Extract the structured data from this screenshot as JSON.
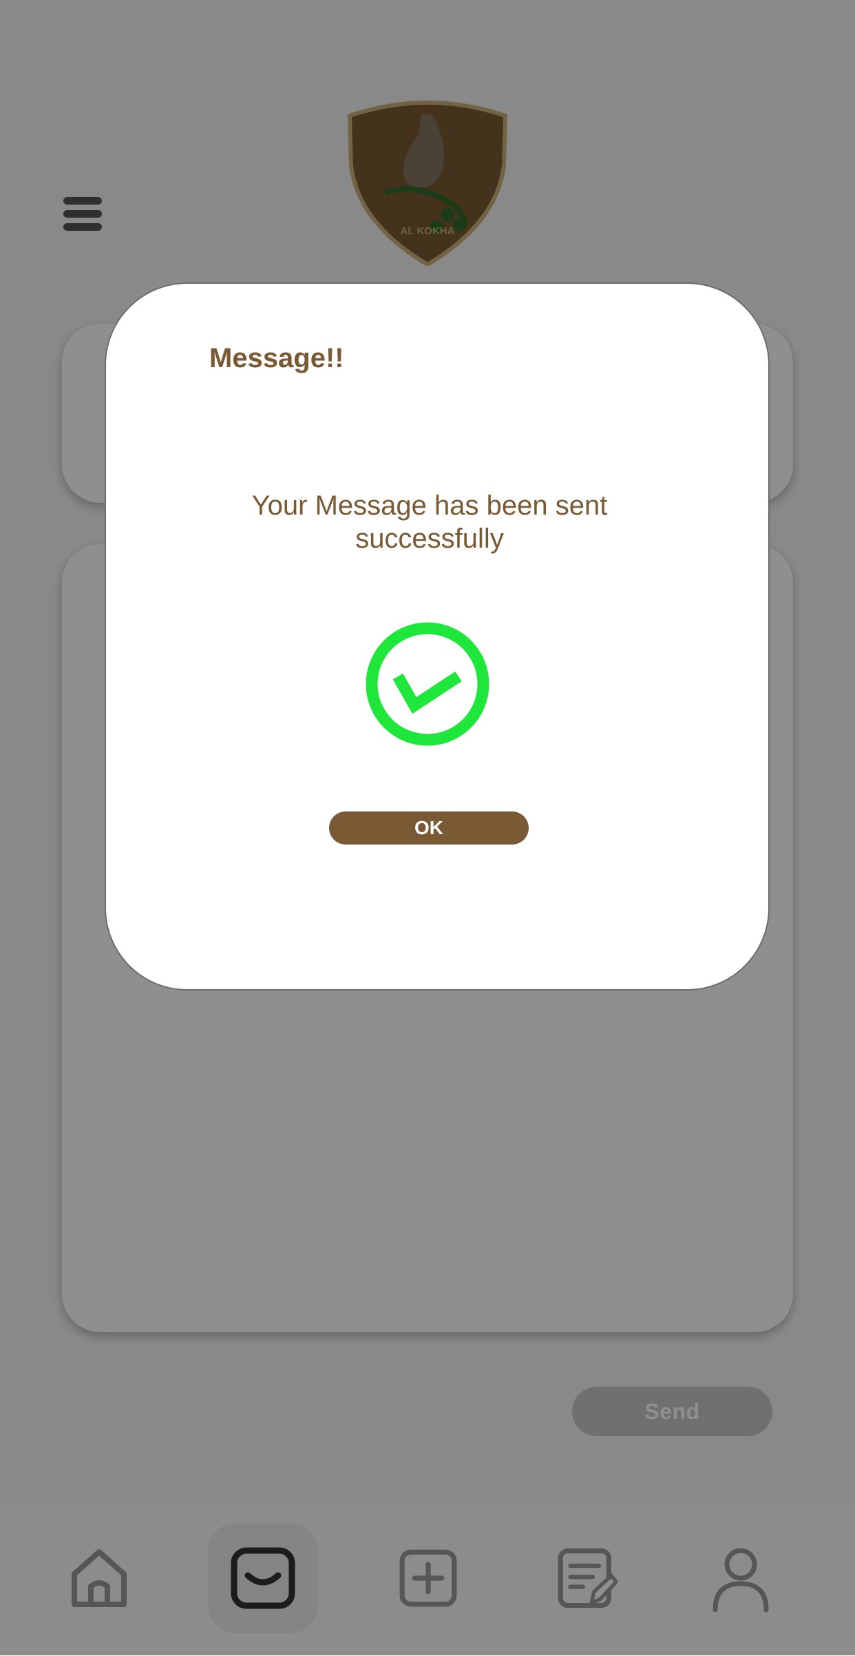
{
  "background": {
    "send_label": "Send",
    "logo_text": "AL KOKHA",
    "nav": [
      {
        "name": "home-icon",
        "active": false
      },
      {
        "name": "inbox-icon",
        "active": true
      },
      {
        "name": "add-icon",
        "active": false
      },
      {
        "name": "edit-icon",
        "active": false
      },
      {
        "name": "profile-icon",
        "active": false
      }
    ]
  },
  "dialog": {
    "title": "Message!!",
    "message": "Your Message has been sent successfully",
    "icon": "check-circle-icon",
    "ok_label": "OK"
  },
  "colors": {
    "brand_brown": "#7a5a34",
    "success_green": "#1ee63a",
    "overlay": "rgba(0,0,0,0.44)"
  }
}
